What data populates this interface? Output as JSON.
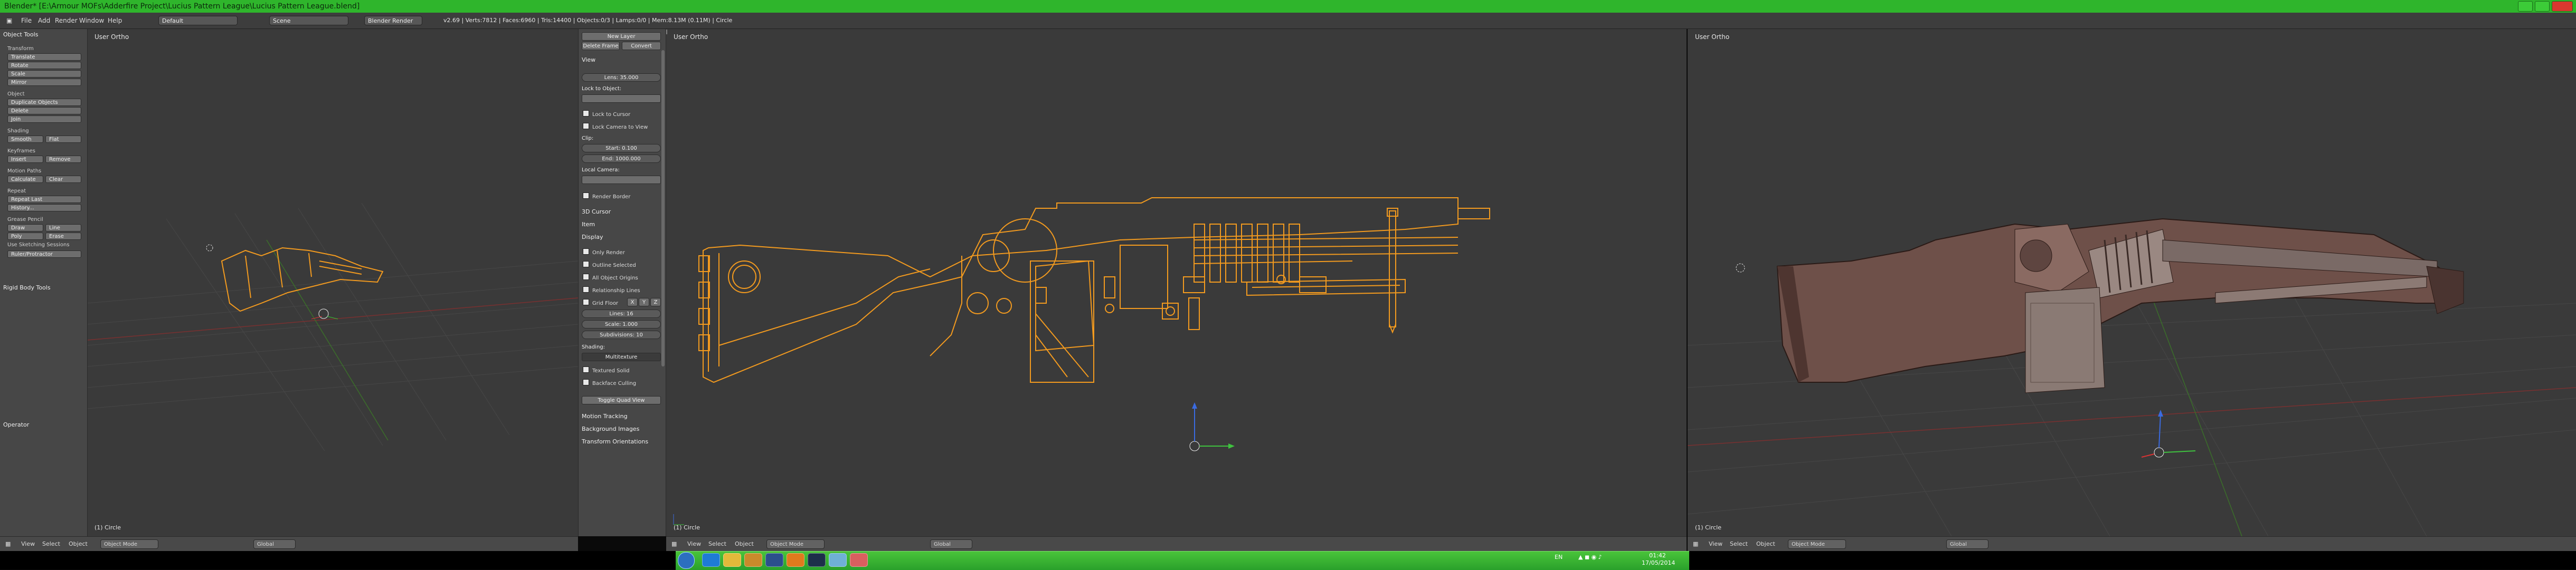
{
  "window": {
    "title": "Blender* [E:\\Armour MOFs\\Adderfire Project\\Lucius Pattern League\\Lucius Pattern League.blend]",
    "close_icon": "close-icon",
    "minimize_icon": "minimize-icon",
    "maximize_icon": "maximize-icon"
  },
  "info_header": {
    "menus": [
      "File",
      "Add",
      "Render",
      "Window",
      "Help"
    ],
    "screen_layout": "Default",
    "scene": "Scene",
    "render_engine": "Blender Render",
    "stats": "v2.69 | Verts:7812 | Faces:6960 | Tris:14400 | Objects:0/3 | Lamps:0/0 | Mem:8.13M (0.11M) | Circle"
  },
  "tool_shelf": {
    "title": "Object Tools",
    "sections": [
      {
        "header": "Transform",
        "buttons": [
          "Translate",
          "Rotate",
          "Scale",
          "Mirror"
        ]
      },
      {
        "header": "Object",
        "buttons": [
          "Duplicate Objects",
          "Delete",
          "Join"
        ]
      },
      {
        "header": "Shading",
        "buttons": [
          "Smooth",
          "Flat"
        ]
      },
      {
        "header": "Keyframes",
        "buttons": [
          "Insert",
          "Remove"
        ]
      },
      {
        "header": "Motion Paths",
        "buttons": [
          "Calculate",
          "Clear"
        ]
      },
      {
        "header": "Repeat",
        "buttons": [
          "Repeat Last",
          "History..."
        ]
      },
      {
        "header": "Grease Pencil",
        "buttons": [
          "Draw",
          "Line",
          "Poly",
          "Erase"
        ]
      }
    ],
    "checkbox": "Use Sketching Sessions",
    "bottom_button": "Ruler/Protractor",
    "rigid_body": "Rigid Body Tools",
    "operator": "Operator"
  },
  "viewports": [
    {
      "label": "User Ortho",
      "frame": "(1) Circle"
    },
    {
      "label": "User Ortho",
      "frame": "(1) Circle"
    },
    {
      "label": "User Ortho",
      "frame": "(1) Circle"
    }
  ],
  "properties_panel": {
    "new_layer": "New Layer",
    "delete_frame": "Delete Frame",
    "convert": "Convert",
    "view_header": "View",
    "lens": "Lens: 35.000",
    "lock_to_object": "Lock to Object:",
    "lock_cursor": "Lock to Cursor",
    "lock_camera": "Lock Camera to View",
    "clip": "Clip:",
    "clip_start": "Start: 0.100",
    "clip_end": "End: 1000.000",
    "local_camera": "Local Camera:",
    "render_border": "Render Border",
    "cursor_3d": "3D Cursor",
    "item": "Item",
    "display": "Display",
    "only_render": "Only Render",
    "outline_selected": "Outline Selected",
    "all_object_origins": "All Object Origins",
    "relationship_lines": "Relationship Lines",
    "grid_floor": "Grid Floor",
    "grid_axes": [
      "X",
      "Y",
      "Z"
    ],
    "lines": "Lines: 16",
    "scale": "Scale: 1.000",
    "subdivisions": "Subdivisions: 10",
    "shading": "Shading:",
    "shading_mode": "Multitexture",
    "textured_solid": "Textured Solid",
    "backface_culling": "Backface Culling",
    "toggle_quad_view": "Toggle Quad View",
    "motion_tracking": "Motion Tracking",
    "background_images": "Background Images",
    "transform_orientations": "Transform Orientations"
  },
  "view_header": {
    "menus": [
      "View",
      "Select",
      "Object"
    ],
    "mode": "Object Mode",
    "orientation": "Global"
  },
  "taskbar": {
    "lang": "EN",
    "time": "01:42",
    "date": "17/05/2014",
    "icons": [
      "skype-icon",
      "chrome-icon",
      "folder-icon",
      "photoshop-icon",
      "blender-icon",
      "steam-icon",
      "notepad-icon",
      "paint-icon"
    ]
  },
  "colors": {
    "title_green": "#2fb52c",
    "wire_orange": "#f29a1f",
    "model_brown": "#7a5a52",
    "viewport_bg": "#3a3a3a"
  }
}
